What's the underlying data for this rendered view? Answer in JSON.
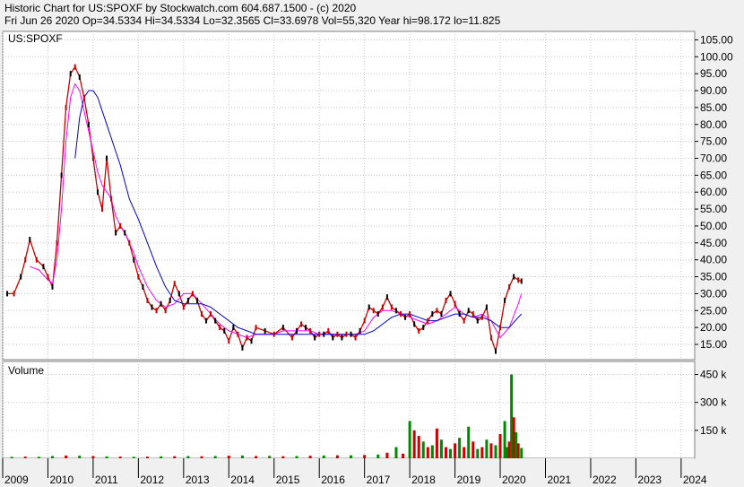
{
  "header": {
    "line1": "Historic Chart for US:SPOXF by Stockwatch.com 604.687.1500 - (c) 2020",
    "line2": "Fri Jun 26 2020   Op=34.5334   Hi=34.5334   Lo=32.3565   Cl=33.6978   Vol=55,320   Year hi=98.172   lo=11.825"
  },
  "price_panel": {
    "label": "US:SPOXF"
  },
  "volume_panel": {
    "label": "Volume"
  },
  "colors": {
    "background": "#ffffff",
    "frame": "#f0f0f0",
    "grid": "#c8c8c8",
    "price_up": "#000000",
    "price_down": "#cc0000",
    "ma_short": "#ff00ff",
    "ma_long": "#0000cc",
    "volume_up": "#008800",
    "volume_down": "#cc0000"
  },
  "chart_data": [
    {
      "type": "line",
      "title": "",
      "xlabel": "",
      "ylabel": "",
      "x_tick_labels": [
        "2009",
        "2010",
        "2011",
        "2012",
        "2013",
        "2014",
        "2015",
        "2016",
        "2017",
        "2018",
        "2019",
        "2020",
        "2021",
        "2022",
        "2023",
        "2024"
      ],
      "x_range": [
        2009.0,
        2024.3
      ],
      "y_tick_labels": [
        "15.00",
        "20.00",
        "25.00",
        "30.00",
        "35.00",
        "40.00",
        "45.00",
        "50.00",
        "55.00",
        "60.00",
        "65.00",
        "70.00",
        "75.00",
        "80.00",
        "85.00",
        "90.00",
        "95.00",
        "100.00",
        "105.00"
      ],
      "ylim": [
        10.5,
        107.5
      ],
      "grid": true,
      "series": [
        {
          "name": "",
          "role": "price",
          "x": [
            2009.1,
            2009.25,
            2009.4,
            2009.5,
            2009.6,
            2009.75,
            2009.9,
            2010.0,
            2010.1,
            2010.2,
            2010.3,
            2010.4,
            2010.5,
            2010.6,
            2010.7,
            2010.8,
            2010.9,
            2011.0,
            2011.1,
            2011.2,
            2011.3,
            2011.4,
            2011.5,
            2011.6,
            2011.7,
            2011.8,
            2011.9,
            2012.0,
            2012.1,
            2012.2,
            2012.3,
            2012.4,
            2012.5,
            2012.6,
            2012.7,
            2012.8,
            2012.9,
            2013.0,
            2013.1,
            2013.2,
            2013.3,
            2013.4,
            2013.5,
            2013.6,
            2013.7,
            2013.8,
            2013.9,
            2014.0,
            2014.1,
            2014.2,
            2014.3,
            2014.4,
            2014.5,
            2014.6,
            2014.8,
            2015.0,
            2015.2,
            2015.4,
            2015.5,
            2015.6,
            2015.7,
            2015.8,
            2015.9,
            2016.0,
            2016.1,
            2016.2,
            2016.3,
            2016.4,
            2016.5,
            2016.6,
            2016.7,
            2016.8,
            2016.9,
            2017.0,
            2017.1,
            2017.2,
            2017.3,
            2017.4,
            2017.5,
            2017.6,
            2017.7,
            2017.8,
            2017.9,
            2018.0,
            2018.1,
            2018.2,
            2018.3,
            2018.4,
            2018.5,
            2018.6,
            2018.7,
            2018.8,
            2018.9,
            2019.0,
            2019.1,
            2019.2,
            2019.3,
            2019.4,
            2019.5,
            2019.6,
            2019.7,
            2019.8,
            2019.9,
            2020.0,
            2020.1,
            2020.2,
            2020.3,
            2020.4,
            2020.47
          ],
          "y": [
            30,
            30,
            35,
            40,
            46,
            40,
            38,
            35,
            32,
            45,
            65,
            85,
            95,
            97,
            94,
            88,
            80,
            70,
            60,
            55,
            70,
            58,
            48,
            50,
            48,
            45,
            40,
            35,
            32,
            28,
            26,
            25,
            27,
            25,
            28,
            33,
            30,
            26,
            28,
            30,
            28,
            24,
            22,
            24,
            22,
            20,
            19,
            16,
            20,
            18,
            14,
            17,
            16,
            20,
            19,
            18,
            20,
            17,
            19,
            21,
            20,
            19,
            17,
            18,
            18,
            19,
            17,
            18,
            17,
            18,
            18,
            17,
            19,
            22,
            26,
            25,
            24,
            26,
            29,
            26,
            25,
            24,
            23,
            24,
            21,
            19,
            20,
            22,
            24,
            25,
            24,
            28,
            30,
            27,
            24,
            22,
            25,
            24,
            22,
            23,
            26,
            17,
            13,
            20,
            28,
            32,
            35,
            34,
            33.7
          ]
        },
        {
          "name": "",
          "role": "short moving average",
          "x": [
            2009.6,
            2009.8,
            2010.0,
            2010.1,
            2010.2,
            2010.3,
            2010.4,
            2010.5,
            2010.6,
            2010.7,
            2010.8,
            2010.9,
            2011.0,
            2011.1,
            2011.2,
            2011.3,
            2011.4,
            2011.5,
            2011.6,
            2011.7,
            2011.8,
            2011.9,
            2012.0,
            2012.2,
            2012.4,
            2012.6,
            2012.8,
            2013.0,
            2013.2,
            2013.4,
            2013.6,
            2013.8,
            2014.0,
            2014.2,
            2014.4,
            2014.6,
            2014.8,
            2015.0,
            2015.2,
            2015.4,
            2015.6,
            2015.8,
            2016.0,
            2016.2,
            2016.4,
            2016.6,
            2016.8,
            2017.0,
            2017.2,
            2017.4,
            2017.6,
            2017.8,
            2018.0,
            2018.2,
            2018.4,
            2018.6,
            2018.8,
            2019.0,
            2019.2,
            2019.4,
            2019.6,
            2019.8,
            2020.0,
            2020.2,
            2020.4,
            2020.47
          ],
          "y": [
            38,
            37,
            34,
            33,
            40,
            55,
            75,
            88,
            92,
            90,
            84,
            78,
            72,
            66,
            62,
            60,
            58,
            53,
            50,
            48,
            45,
            42,
            38,
            32,
            28,
            26,
            27,
            30,
            30,
            27,
            24,
            21,
            19,
            18,
            17,
            18,
            18,
            18,
            19,
            19,
            19,
            19,
            18,
            18,
            18,
            18,
            18,
            19,
            23,
            25,
            25,
            24,
            23,
            22,
            21,
            22,
            24,
            26,
            24,
            23,
            24,
            22,
            17,
            20,
            27,
            30
          ]
        },
        {
          "name": "",
          "role": "long moving average",
          "x": [
            2010.6,
            2010.7,
            2010.8,
            2010.9,
            2011.0,
            2011.1,
            2011.2,
            2011.3,
            2011.4,
            2011.5,
            2011.6,
            2011.7,
            2011.8,
            2011.9,
            2012.0,
            2012.2,
            2012.4,
            2012.6,
            2012.8,
            2013.0,
            2013.2,
            2013.4,
            2013.6,
            2013.8,
            2014.0,
            2014.2,
            2014.4,
            2014.6,
            2014.8,
            2015.0,
            2015.2,
            2015.4,
            2015.6,
            2015.8,
            2016.0,
            2016.2,
            2016.4,
            2016.6,
            2016.8,
            2017.0,
            2017.2,
            2017.4,
            2017.6,
            2017.8,
            2018.0,
            2018.2,
            2018.4,
            2018.6,
            2018.8,
            2019.0,
            2019.2,
            2019.4,
            2019.6,
            2019.8,
            2020.0,
            2020.2,
            2020.4,
            2020.47
          ],
          "y": [
            70,
            82,
            88,
            90,
            90,
            88,
            84,
            80,
            76,
            72,
            68,
            63,
            58,
            55,
            52,
            45,
            38,
            32,
            28,
            27,
            27,
            27,
            26,
            24,
            22,
            20,
            19,
            18,
            18,
            18,
            18,
            18,
            18,
            18,
            18,
            18,
            18,
            18,
            18,
            18,
            19,
            21,
            23,
            24,
            24,
            23,
            22,
            22,
            23,
            24,
            24,
            23,
            23,
            22,
            20,
            20,
            23,
            24
          ]
        }
      ]
    },
    {
      "type": "bar",
      "title": "",
      "xlabel": "",
      "ylabel": "Volume",
      "y_tick_labels": [
        "150 k",
        "300 k",
        "450 k"
      ],
      "ylim": [
        0,
        520000
      ],
      "grid": true,
      "series": [
        {
          "name": "",
          "role": "volume",
          "x": [
            2009.2,
            2009.5,
            2009.8,
            2010.1,
            2010.4,
            2010.7,
            2011.0,
            2011.3,
            2011.6,
            2011.9,
            2012.2,
            2012.5,
            2012.8,
            2013.1,
            2013.4,
            2013.7,
            2014.0,
            2014.3,
            2014.6,
            2014.9,
            2015.2,
            2015.5,
            2015.8,
            2016.1,
            2016.4,
            2016.7,
            2017.0,
            2017.3,
            2017.5,
            2017.7,
            2017.85,
            2018.0,
            2018.1,
            2018.2,
            2018.3,
            2018.4,
            2018.5,
            2018.6,
            2018.7,
            2018.8,
            2018.9,
            2019.0,
            2019.1,
            2019.2,
            2019.3,
            2019.4,
            2019.5,
            2019.6,
            2019.7,
            2019.8,
            2019.9,
            2020.0,
            2020.1,
            2020.15,
            2020.2,
            2020.25,
            2020.3,
            2020.35,
            2020.4,
            2020.47
          ],
          "values": [
            8000,
            9000,
            8000,
            12000,
            15000,
            14000,
            12000,
            10000,
            9000,
            8000,
            9000,
            10000,
            11000,
            12000,
            11000,
            12000,
            14000,
            15000,
            12000,
            13000,
            11000,
            12000,
            14000,
            15000,
            16000,
            16000,
            18000,
            20000,
            30000,
            60000,
            25000,
            200000,
            150000,
            120000,
            90000,
            60000,
            70000,
            160000,
            100000,
            60000,
            50000,
            80000,
            110000,
            60000,
            170000,
            90000,
            50000,
            60000,
            100000,
            80000,
            70000,
            130000,
            200000,
            60000,
            90000,
            450000,
            220000,
            140000,
            80000,
            55320
          ],
          "direction": [
            "up",
            "down",
            "up",
            "up",
            "down",
            "up",
            "down",
            "up",
            "down",
            "up",
            "down",
            "up",
            "down",
            "up",
            "down",
            "up",
            "down",
            "up",
            "down",
            "up",
            "down",
            "up",
            "down",
            "up",
            "down",
            "up",
            "down",
            "up",
            "down",
            "up",
            "down",
            "up",
            "down",
            "down",
            "up",
            "down",
            "up",
            "down",
            "up",
            "down",
            "up",
            "down",
            "up",
            "down",
            "up",
            "down",
            "up",
            "down",
            "up",
            "down",
            "up",
            "down",
            "up",
            "up",
            "down",
            "up",
            "down",
            "up",
            "down",
            "up"
          ]
        }
      ]
    }
  ]
}
